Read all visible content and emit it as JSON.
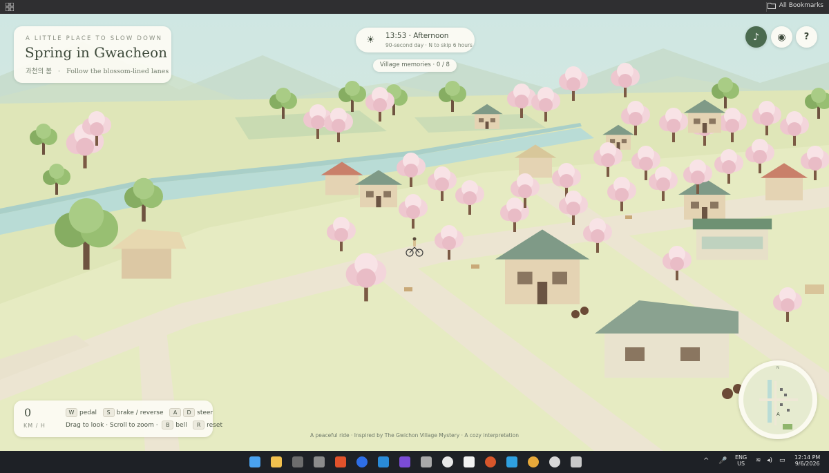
{
  "browser": {
    "bookmarks_label": "All Bookmarks"
  },
  "hud": {
    "kicker": "A LITTLE PLACE TO SLOW DOWN",
    "title": "Spring in Gwacheon",
    "korean_title": "과천의 봄",
    "separator": "·",
    "tagline": "Follow the blossom-lined lanes",
    "time": "13:53 · Afternoon",
    "time_hint": "90-second day · N to skip 6 hours",
    "memories": "Village memories · 0 / 8",
    "speed_value": "0",
    "speed_unit": "KM / H",
    "controls": {
      "w": "W",
      "pedal": "pedal",
      "s": "S",
      "brake": "brake / reverse",
      "a": "A",
      "d": "D",
      "steer": "steer",
      "look": "Drag to look · Scroll to zoom ·",
      "b": "B",
      "bell": "bell",
      "r": "R",
      "reset": "reset"
    },
    "footer": "A peaceful ride · Inspired by The Gwichon Village Mystery · A cozy interpretation",
    "buttons": [
      {
        "name": "music",
        "icon": "music-note-icon"
      },
      {
        "name": "record",
        "icon": "record-icon"
      },
      {
        "name": "help",
        "icon": "help-icon",
        "glyph": "?"
      }
    ]
  },
  "taskbar": {
    "language": "ENG",
    "region": "US",
    "time": "12:14 PM",
    "date": "9/6/2026"
  },
  "colors": {
    "grass": "#dfe6b8",
    "path": "#ece5d2",
    "water": "#b9dcd6",
    "blossom": "#f0d0d6",
    "green_tree": "#8fb56c",
    "roof_green": "#7f9a87",
    "accent": "#4b6b4f"
  }
}
